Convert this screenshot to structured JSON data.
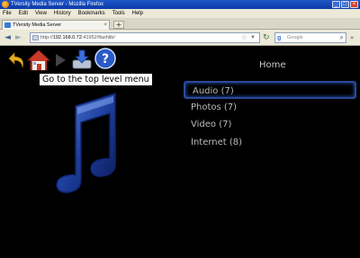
{
  "window": {
    "title": "TVersity Media Server - Mozilla Firefox",
    "buttons": [
      "_",
      "□",
      "×"
    ]
  },
  "menubar": [
    "File",
    "Edit",
    "View",
    "History",
    "Bookmarks",
    "Tools",
    "Help"
  ],
  "tabs": [
    {
      "label": "TVersity Media Server",
      "close": "×"
    }
  ],
  "new_tab": "+",
  "nav": {
    "back": "◄",
    "forward": "►",
    "url_prefix": "http://",
    "url_host": "192.168.0.72",
    "url_rest": ":41952/flashlib/",
    "reload": "↻",
    "search_placeholder": "Google",
    "search_engine": "g"
  },
  "toolbar_icons": [
    "back-arrow-icon",
    "home-icon",
    "play-icon",
    "download-icon",
    "help-icon"
  ],
  "tooltip": "Go to the top level menu",
  "menu": {
    "title": "Home",
    "items": [
      {
        "label": "Audio (7)",
        "selected": true
      },
      {
        "label": "Photos (7)",
        "selected": false
      },
      {
        "label": "Video (7)",
        "selected": false
      },
      {
        "label": "Internet (8)",
        "selected": false
      }
    ]
  },
  "colors": {
    "background": "#000000",
    "accent_blue": "#2a59c8",
    "home_red": "#c83a2a",
    "back_yellow": "#e8b020"
  }
}
